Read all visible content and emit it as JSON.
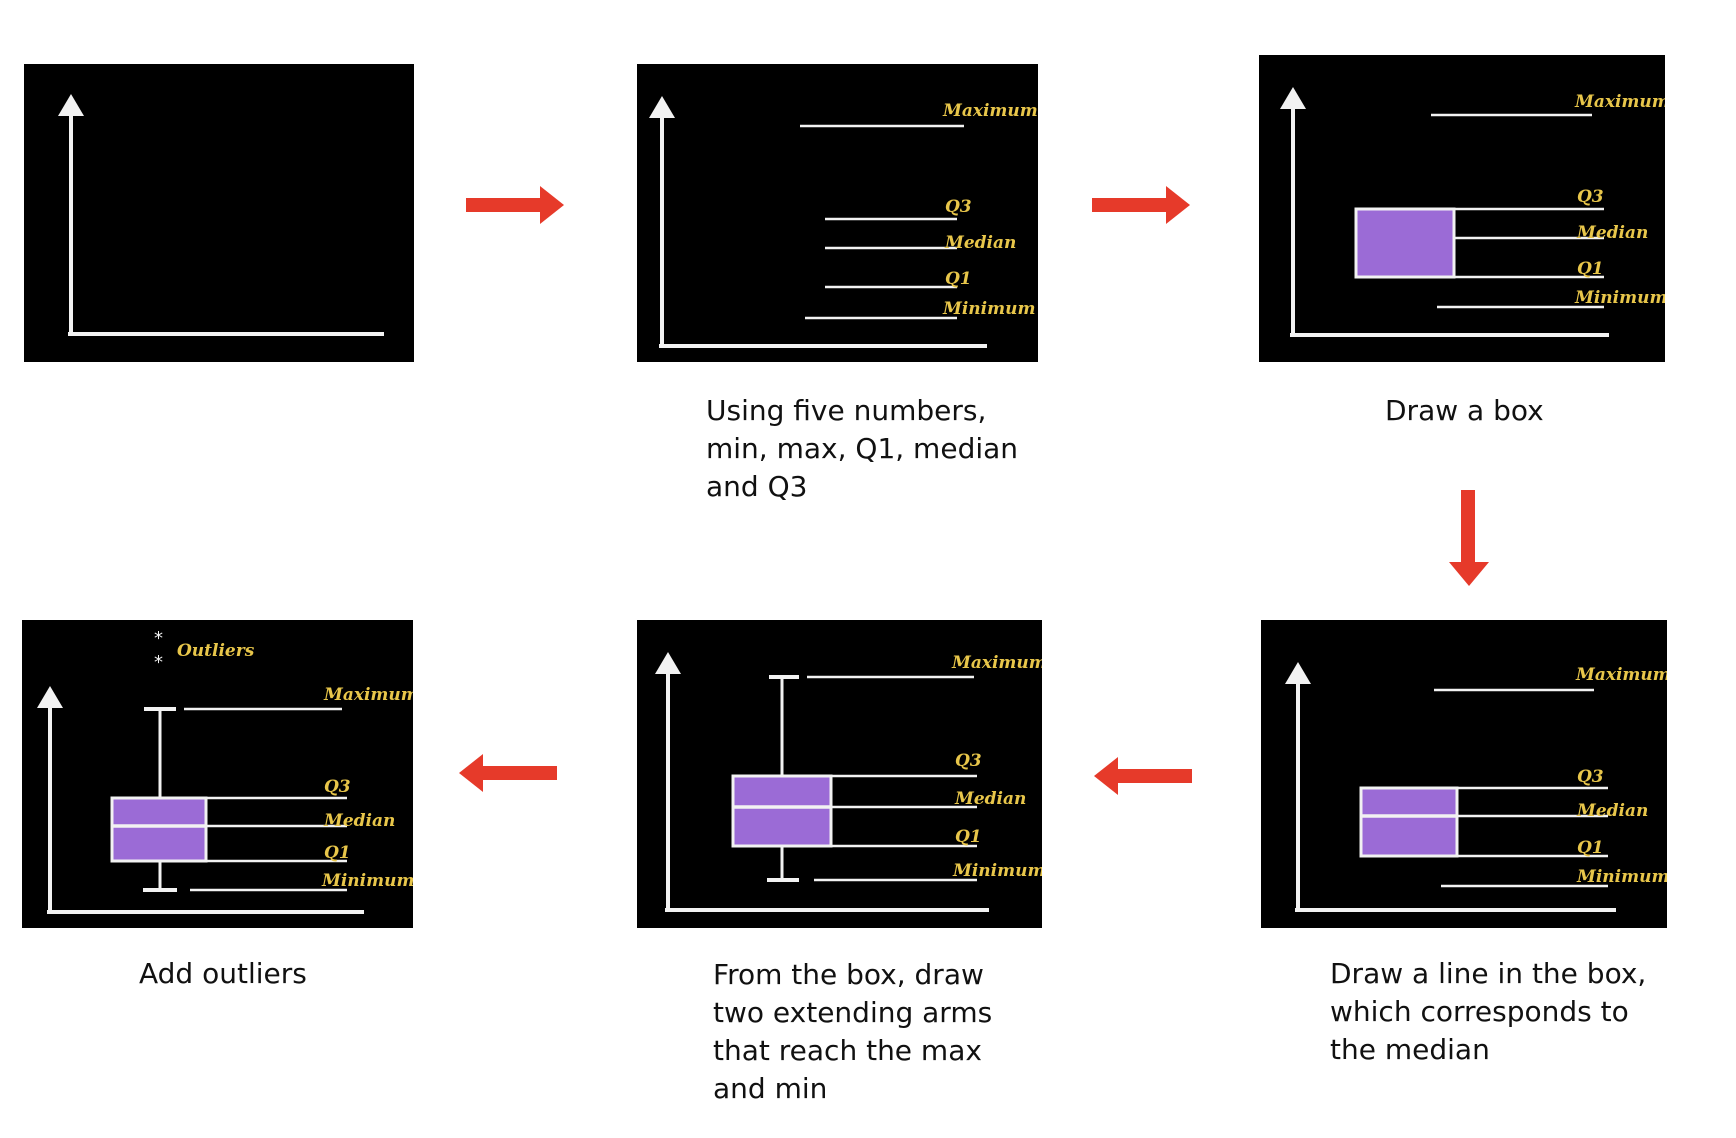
{
  "labels": {
    "maximum": "Maximum",
    "q3": "Q3",
    "median": "Median",
    "q1": "Q1",
    "minimum": "Minimum",
    "outliers": "Outliers",
    "star": "*"
  },
  "steps": [
    {
      "caption": ""
    },
    {
      "caption": "Using five numbers,\nmin, max, Q1, median\nand Q3"
    },
    {
      "caption": "Draw a box"
    },
    {
      "caption": "Draw a line in the box,\nwhich corresponds to\nthe median"
    },
    {
      "caption": "From the box, draw\ntwo extending arms\nthat reach the max\nand min"
    },
    {
      "caption": "Add outliers"
    }
  ],
  "colors": {
    "panel_bg": "#000000",
    "chalk": "#f2f2f2",
    "label": "#e8c64a",
    "box_fill": "#9b6bd6",
    "arrow": "#e63a2a"
  }
}
